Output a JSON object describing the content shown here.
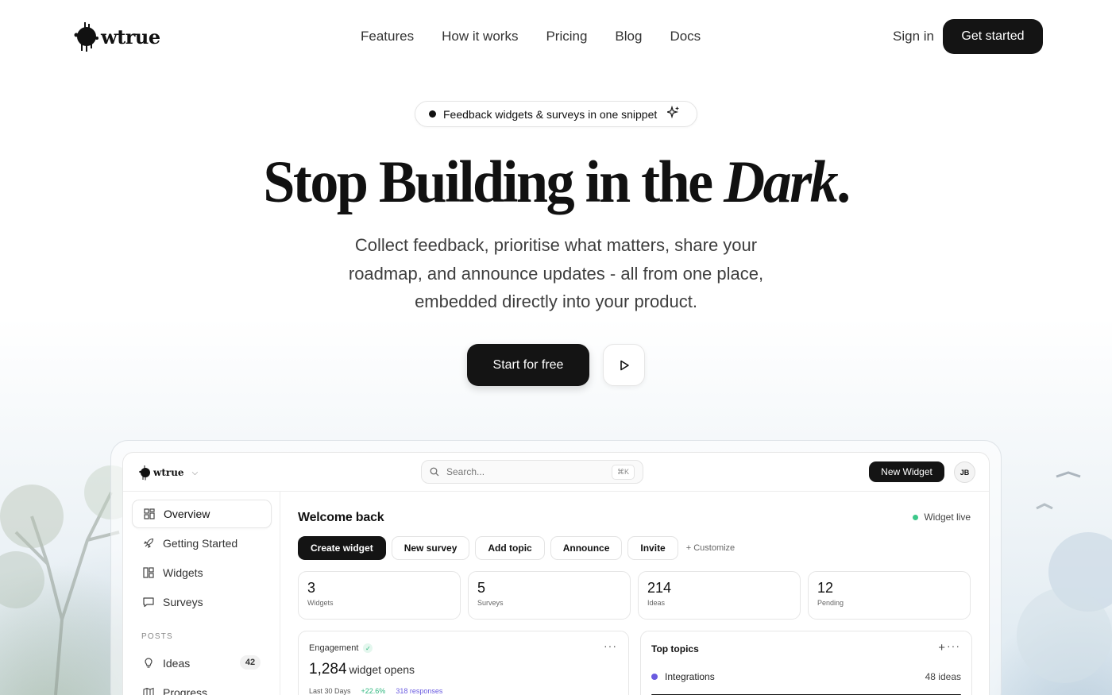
{
  "nav": {
    "logo": "wtrue",
    "links": [
      "Features",
      "How it works",
      "Pricing",
      "Blog",
      "Docs"
    ],
    "sign_in": "Sign in",
    "get_started": "Get started"
  },
  "hero": {
    "pill": "Feedback widgets & surveys in one snippet",
    "headline_plain": "Stop Building in the ",
    "headline_italic": "Dark",
    "headline_end": ".",
    "subtitle": "Collect feedback, prioritise what matters, share your roadmap, and announce updates - all from one place, embedded directly into your product.",
    "cta": "Start for free"
  },
  "app": {
    "logo": "wtrue",
    "search_placeholder": "Search...",
    "search_shortcut": "⌘K",
    "new_widget": "New Widget",
    "avatar": "JB",
    "sidebar": {
      "items": [
        {
          "label": "Overview"
        },
        {
          "label": "Getting Started"
        },
        {
          "label": "Widgets"
        },
        {
          "label": "Surveys"
        }
      ],
      "section": "POSTS",
      "posts": [
        {
          "label": "Ideas",
          "badge": "42"
        },
        {
          "label": "Progress"
        }
      ]
    },
    "main": {
      "welcome": "Welcome back",
      "status": "Widget live",
      "chips": [
        "Create widget",
        "New survey",
        "Add topic",
        "Announce",
        "Invite"
      ],
      "customize": "+ Customize",
      "stats": [
        {
          "value": "3",
          "label": "Widgets"
        },
        {
          "value": "5",
          "label": "Surveys"
        },
        {
          "value": "214",
          "label": "Ideas"
        },
        {
          "value": "12",
          "label": "Pending"
        }
      ],
      "engagement": {
        "title": "Engagement",
        "value": "1,284",
        "unit": "widget opens",
        "period": "Last 30 Days",
        "change": "+22.6%",
        "responses": "318 responses"
      },
      "topics": {
        "title": "Top topics",
        "items": [
          {
            "name": "Integrations",
            "count": "48 ideas"
          }
        ]
      }
    }
  },
  "colors": {
    "accent_dark": "#141414",
    "success": "#3cc88a",
    "purple": "#6a5be0"
  }
}
